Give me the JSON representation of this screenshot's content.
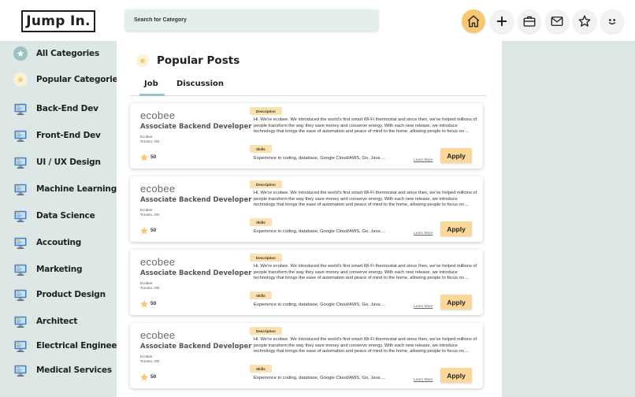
{
  "app": {
    "logo_text": "Jump In."
  },
  "search": {
    "placeholder": "Search for Category"
  },
  "header_icons": [
    "home-icon",
    "plus-icon",
    "briefcase-icon",
    "mail-icon",
    "star-icon",
    "smiley-icon"
  ],
  "colors": {
    "accent_teal": "#9cc3c3",
    "accent_yellow": "#f7c871",
    "apply_button": "#fbd79a",
    "badge": "#fbe1b0",
    "sidebar_bg": "#dde8e6"
  },
  "sidebar": {
    "items": [
      {
        "label": "All Categories",
        "icon": "star-icon"
      },
      {
        "label": "Popular Categories",
        "icon": "star-icon"
      },
      {
        "label": "Back-End Dev",
        "icon": "computer-icon"
      },
      {
        "label": "Front-End Dev",
        "icon": "computer-icon"
      },
      {
        "label": "UI / UX Design",
        "icon": "computer-icon"
      },
      {
        "label": "Machine Learning",
        "icon": "computer-icon"
      },
      {
        "label": "Data Science",
        "icon": "computer-icon"
      },
      {
        "label": "Accouting",
        "icon": "computer-icon"
      },
      {
        "label": "Marketing",
        "icon": "computer-icon"
      },
      {
        "label": "Product Design",
        "icon": "computer-icon"
      },
      {
        "label": "Architect",
        "icon": "computer-icon"
      },
      {
        "label": "Electrical Engineer",
        "icon": "computer-icon"
      },
      {
        "label": "Medical Services",
        "icon": "computer-icon"
      }
    ]
  },
  "main": {
    "title": "Popular Posts",
    "tabs": [
      {
        "label": "Job"
      },
      {
        "label": "Discussion"
      }
    ],
    "posts": [
      {
        "brand": "ecobee",
        "title": "Associate Backend Developer",
        "company": "Ecobee",
        "location": "Toronto, ON",
        "score": "50",
        "description_label": "Description",
        "description": "Hi. We're ecobee. We introduced the world's first smart Wi-Fi thermostat and since then, we've helped millions of people transform the way they save money and conserve energy. With each new release, we introduce technology that brings the ease of automation and peace of mind to the home, allowing people to focus on ...",
        "skills_label": "Skills",
        "skills": "Experience in coding, database, Google Cloud/AWS, Go, Java ...",
        "learn_more": "Learn More",
        "apply": "Apply"
      },
      {
        "brand": "ecobee",
        "title": "Associate Backend Developer",
        "company": "Ecobee",
        "location": "Toronto, ON",
        "score": "50",
        "description_label": "Description",
        "description": "Hi. We're ecobee. We introduced the world's first smart Wi-Fi thermostat and since then, we've helped millions of people transform the way they save money and conserve energy. With each new release, we introduce technology that brings the ease of automation and peace of mind to the home, allowing people to focus on ...",
        "skills_label": "Skills",
        "skills": "Experience in coding, database, Google Cloud/AWS, Go, Java ...",
        "learn_more": "Learn More",
        "apply": "Apply"
      },
      {
        "brand": "ecobee",
        "title": "Associate Backend Developer",
        "company": "Ecobee",
        "location": "Toronto, ON",
        "score": "50",
        "description_label": "Description",
        "description": "Hi. We're ecobee. We introduced the world's first smart Wi-Fi thermostat and since then, we've helped millions of people transform the way they save money and conserve energy. With each new release, we introduce technology that brings the ease of automation and peace of mind to the home, allowing people to focus on ...",
        "skills_label": "Skills",
        "skills": "Experience in coding, database, Google Cloud/AWS, Go, Java ...",
        "learn_more": "Learn More",
        "apply": "Apply"
      },
      {
        "brand": "ecobee",
        "title": "Associate Backend Developer",
        "company": "Ecobee",
        "location": "Toronto, ON",
        "score": "50",
        "description_label": "Description",
        "description": "Hi. We're ecobee. We introduced the world's first smart Wi-Fi thermostat and since then, we've helped millions of people transform the way they save money and conserve energy. With each new release, we introduce technology that brings the ease of automation and peace of mind to the home, allowing people to focus on ...",
        "skills_label": "Skills",
        "skills": "Experience in coding, database, Google Cloud/AWS, Go, Java ...",
        "learn_more": "Learn More",
        "apply": "Apply"
      }
    ]
  }
}
